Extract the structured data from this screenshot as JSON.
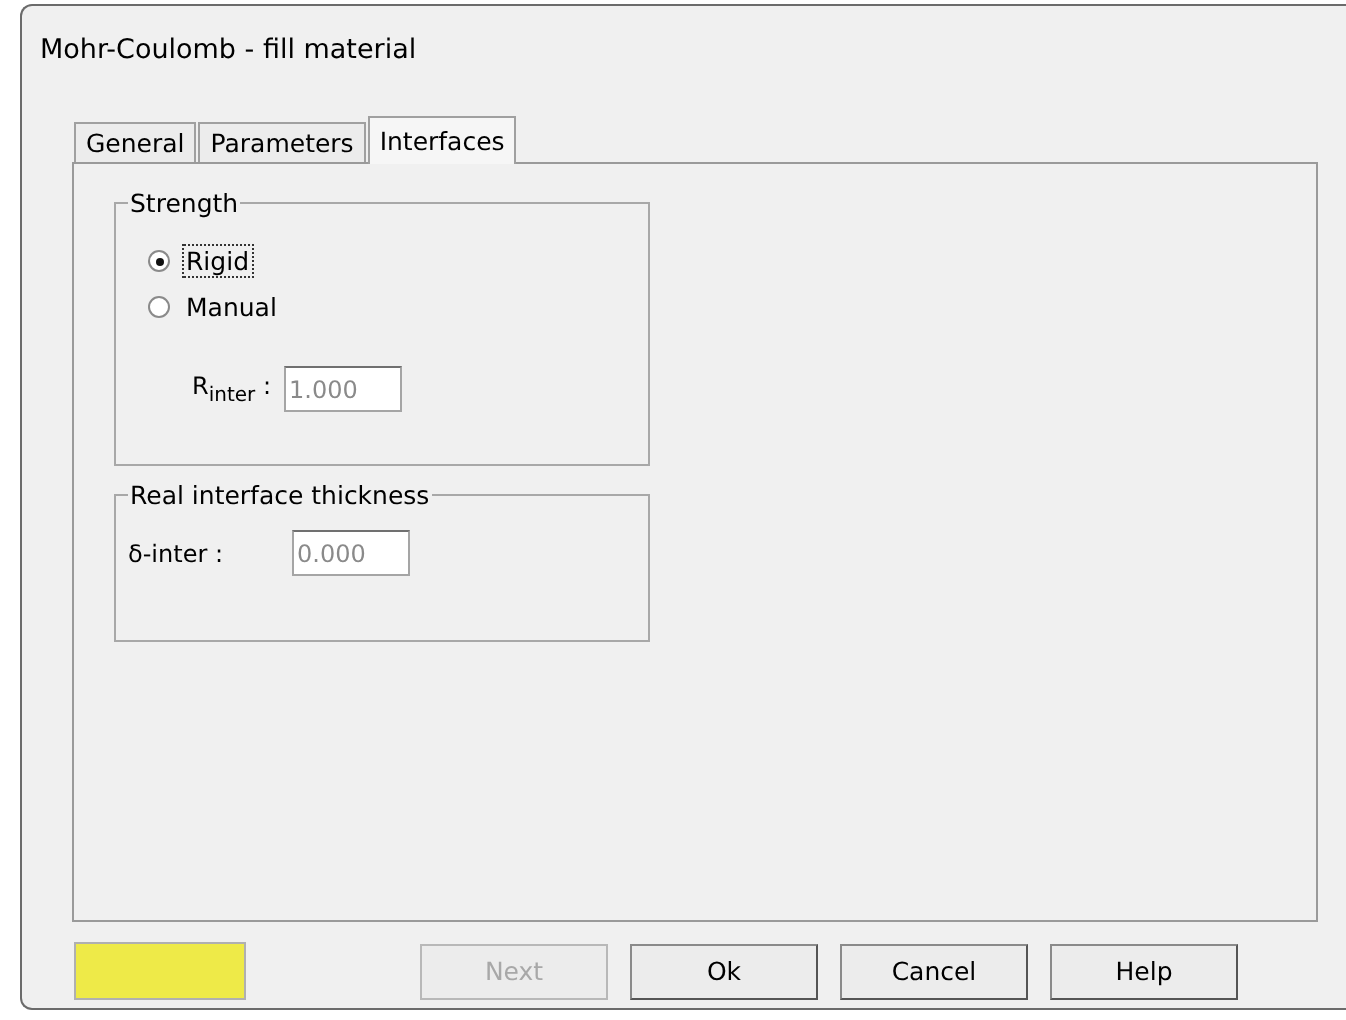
{
  "window": {
    "title": "Mohr-Coulomb - fill material"
  },
  "tabs": [
    {
      "label": "General",
      "selected": false
    },
    {
      "label": "Parameters",
      "selected": false
    },
    {
      "label": "Interfaces",
      "selected": true
    }
  ],
  "strength": {
    "title": "Strength",
    "options": [
      {
        "label": "Rigid",
        "selected": true,
        "focused": true
      },
      {
        "label": "Manual",
        "selected": false,
        "focused": false
      }
    ],
    "field": {
      "label": "R$_{inter}$ :",
      "value": "1.000",
      "disabled": true
    }
  },
  "thickness": {
    "title": "Real interface thickness",
    "field": {
      "label": "δ-inter :",
      "value": "0.000",
      "disabled": true
    }
  },
  "swatch": {
    "color": "#eeea48"
  },
  "buttons": [
    {
      "label": "Next",
      "disabled": true
    },
    {
      "label": "Ok",
      "disabled": false
    },
    {
      "label": "Cancel",
      "disabled": false
    },
    {
      "label": "Help",
      "disabled": false
    }
  ]
}
